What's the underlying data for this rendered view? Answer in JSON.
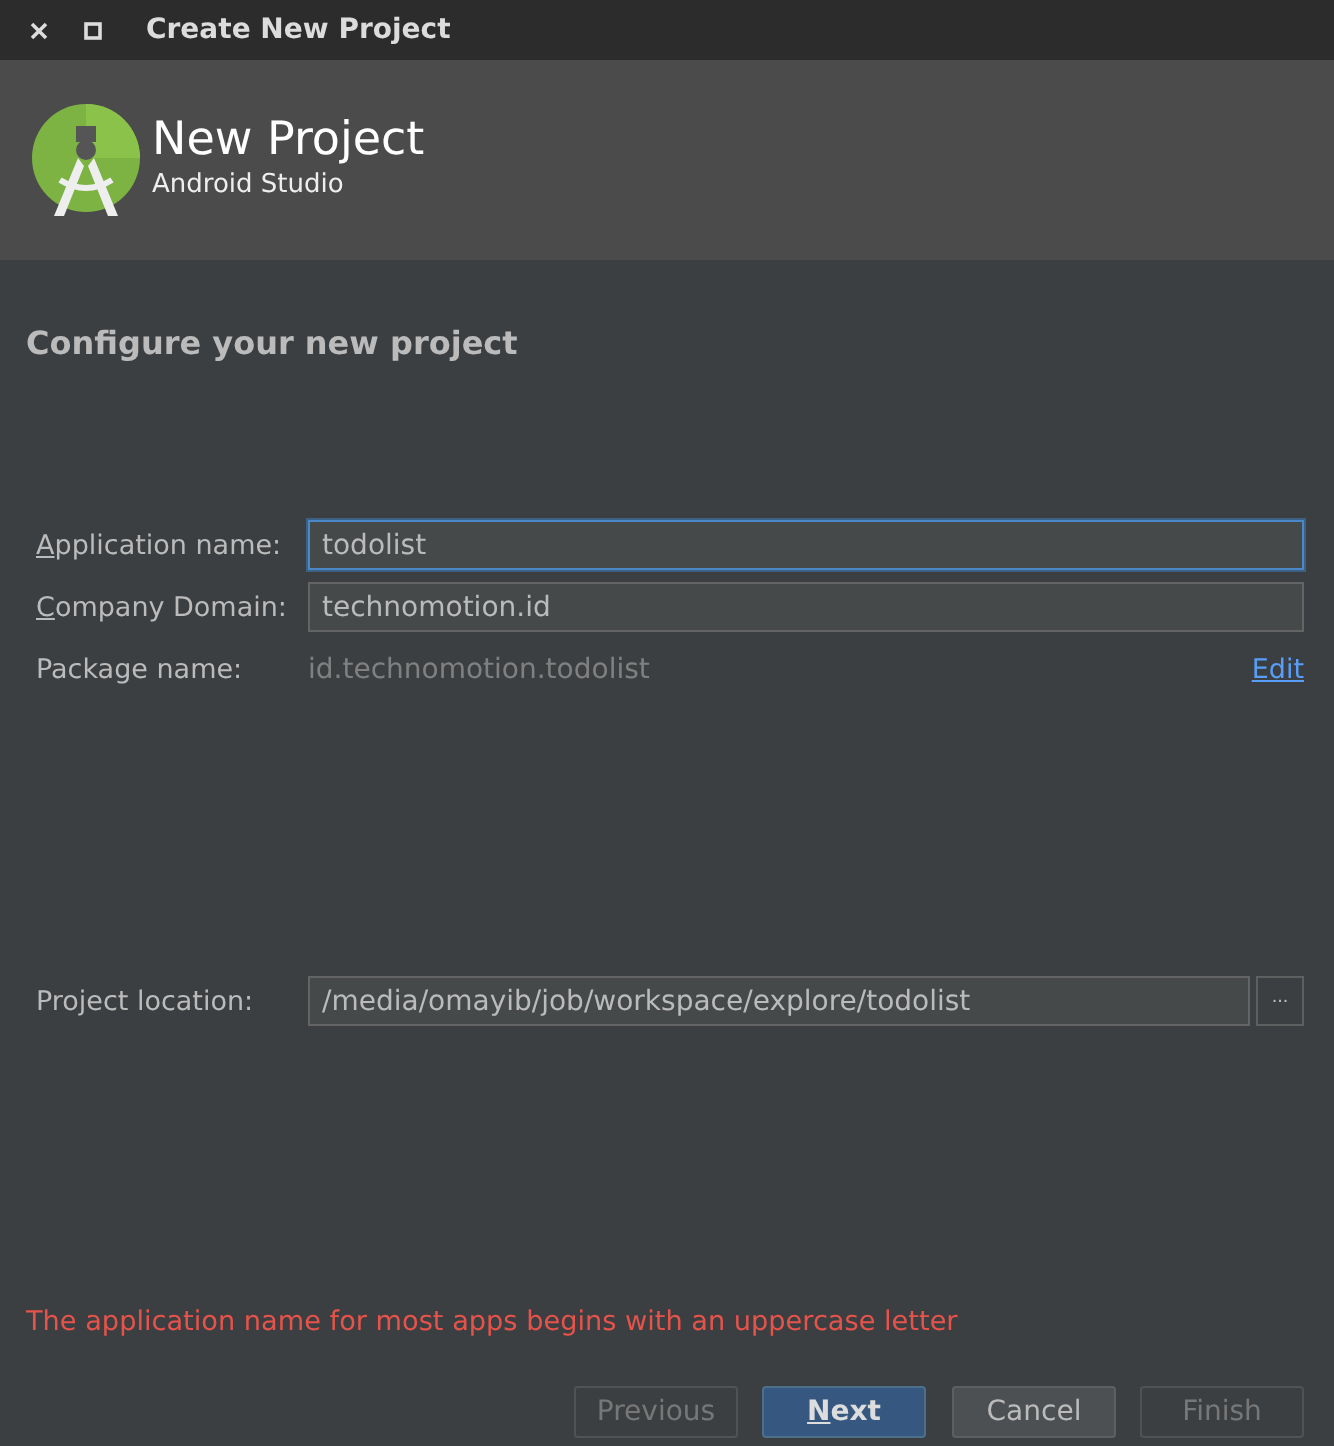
{
  "window": {
    "title": "Create New Project"
  },
  "header": {
    "title": "New Project",
    "subtitle": "Android Studio"
  },
  "heading": "Configure your new project",
  "fields": [
    {
      "kind": "input",
      "label": "Application name:",
      "underline_first": true,
      "value": "todolist",
      "focused": true
    },
    {
      "kind": "input",
      "label": "Company Domain:",
      "underline_first": true,
      "value": "technomotion.id",
      "focused": false
    },
    {
      "kind": "readonly",
      "label": "Package name:",
      "underline_first": false,
      "value": "id.technomotion.todolist",
      "link": "Edit"
    }
  ],
  "location": {
    "label": "Project location:",
    "value": "/media/omayib/job/workspace/explore/todolist",
    "browse": "..."
  },
  "error": "The application name for most apps begins with an uppercase letter",
  "buttons": [
    {
      "label": "Previous",
      "disabled": true,
      "default": false,
      "underline_first": false
    },
    {
      "label": "Next",
      "disabled": false,
      "default": true,
      "underline_first": true
    },
    {
      "label": "Cancel",
      "disabled": false,
      "default": false,
      "underline_first": false
    },
    {
      "label": "Finish",
      "disabled": true,
      "default": false,
      "underline_first": false
    }
  ]
}
